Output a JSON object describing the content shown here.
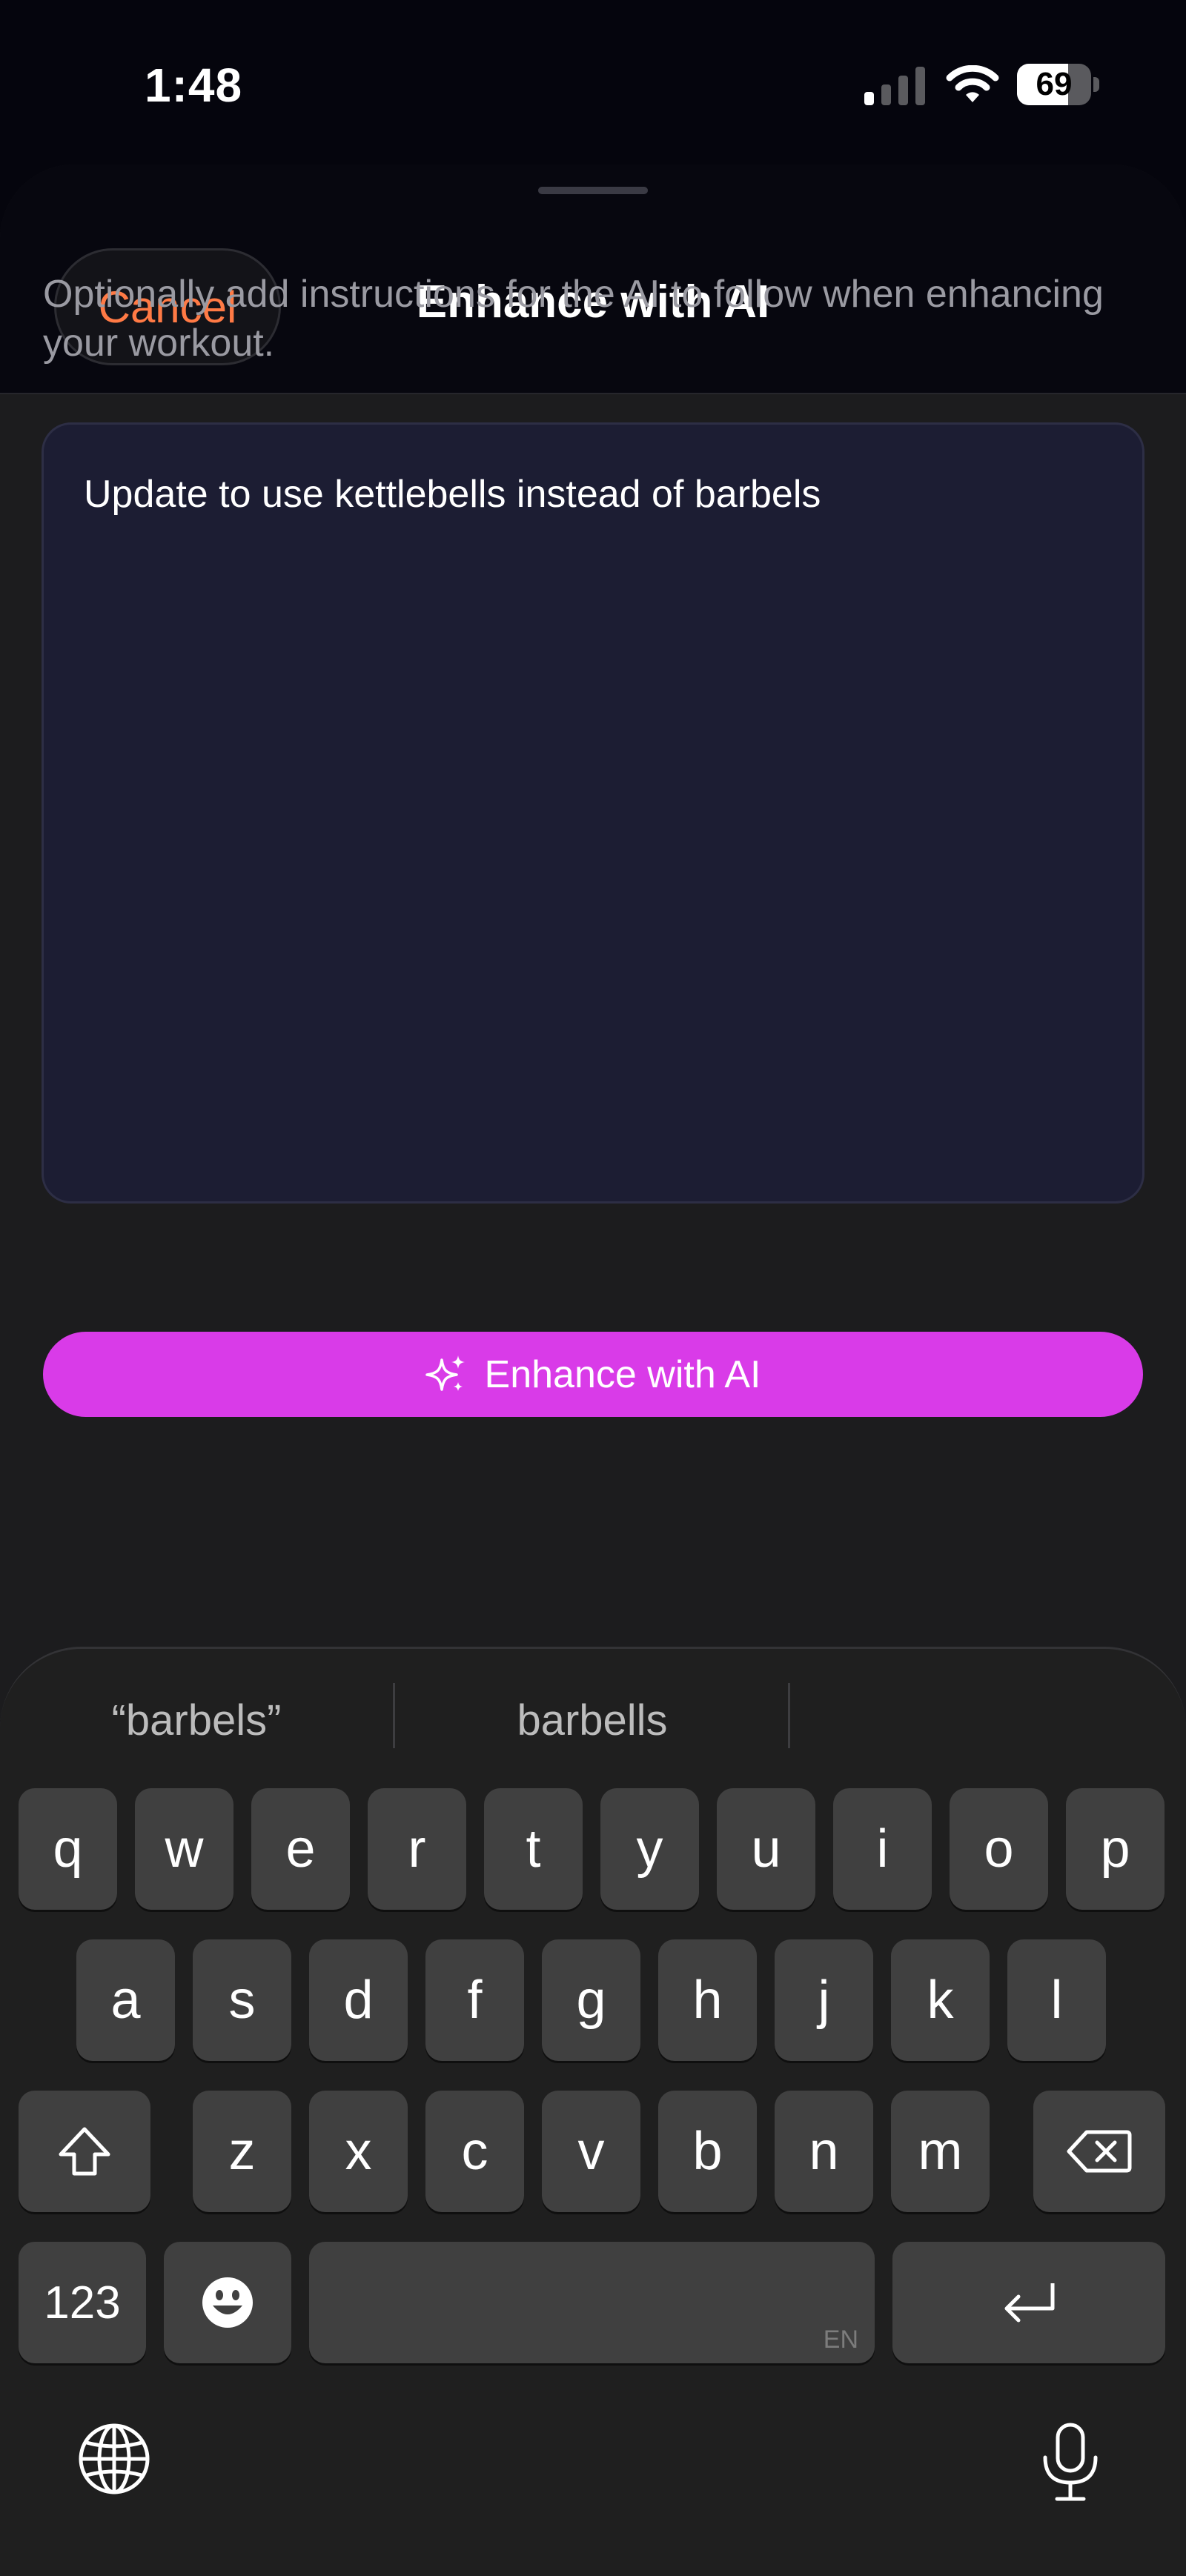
{
  "status_bar": {
    "time": "1:48",
    "battery_percent": 69,
    "battery_label": "69",
    "signal_bars_active": 1
  },
  "sheet": {
    "cancel_label": "Cancel",
    "title": "Enhance with AI",
    "instructions": "Optionally add instructions for the AI to follow when enhancing your workout.",
    "textarea_value": "Update to use kettlebells instead of barbels",
    "enhance_button_label": "Enhance with AI",
    "enhance_icon": "sparkles-icon"
  },
  "keyboard": {
    "suggestions": [
      "“barbels”",
      "barbells",
      ""
    ],
    "row1": [
      "q",
      "w",
      "e",
      "r",
      "t",
      "y",
      "u",
      "i",
      "o",
      "p"
    ],
    "row2": [
      "a",
      "s",
      "d",
      "f",
      "g",
      "h",
      "j",
      "k",
      "l"
    ],
    "row3": [
      "z",
      "x",
      "c",
      "v",
      "b",
      "n",
      "m"
    ],
    "numbers_label": "123",
    "space_language": "EN",
    "icons": [
      "shift-icon",
      "backspace-icon",
      "emoji-icon",
      "return-icon",
      "globe-icon",
      "microphone-icon"
    ]
  },
  "colors": {
    "accent_cancel": "#ff7a45",
    "accent_button": "#d93be8",
    "textarea_bg": "#1c1d33"
  }
}
